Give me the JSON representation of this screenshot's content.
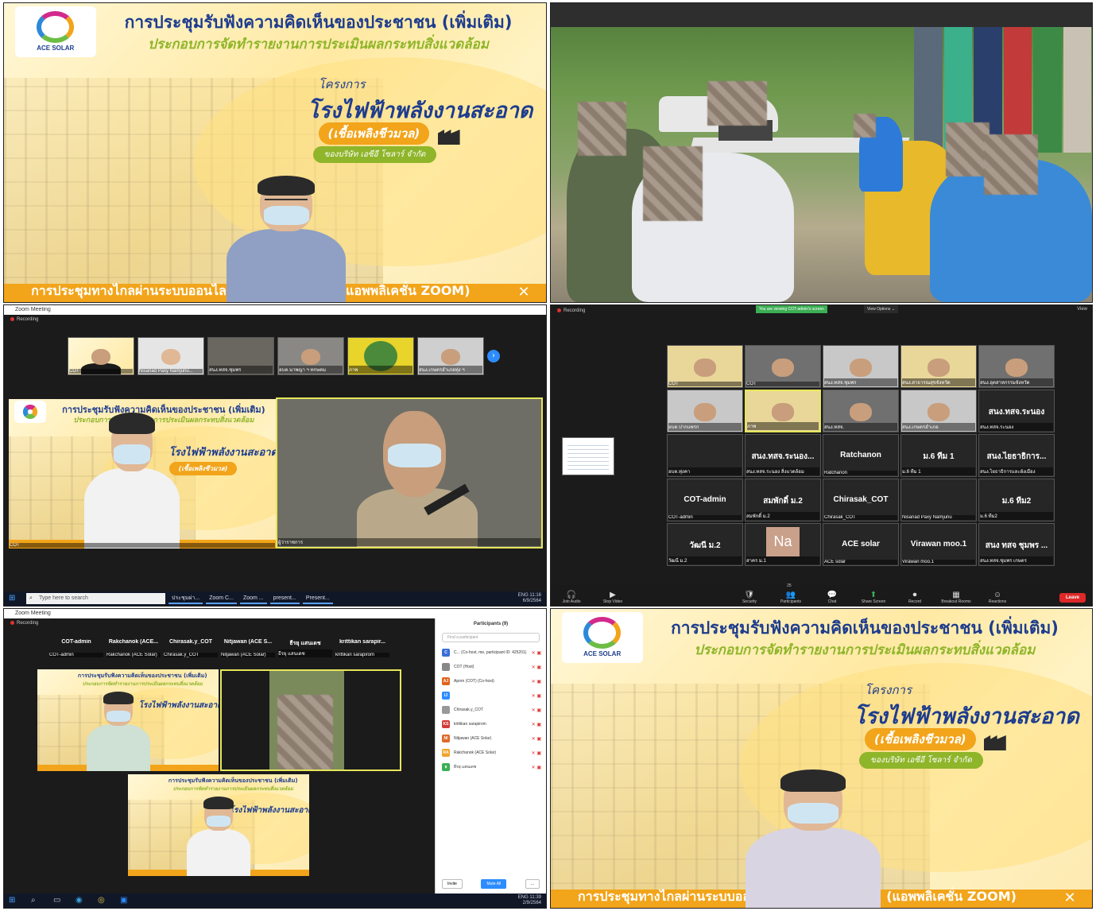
{
  "banner": {
    "logo_text": "ACE SOLAR",
    "title_line1": "การประชุมรับฟังความคิดเห็นของประชาชน (เพิ่มเติม)",
    "title_line2": "ประกอบการจัดทำรายงานการประเมินผลกระทบสิ่งแวดล้อม",
    "project_label": "โครงการ",
    "project_name": "โรงไฟฟ้าพลังงานสะอาด",
    "fuel": "(เชื้อเพลิงชีวมวล)",
    "company": "ของบริษัท เอซีอี โซลาร์ จำกัด",
    "bottom_left": "การประชุมทางไกลผ่านระบบออนไลน์",
    "bottom_right": "(แอพพลิเคชั่น ZOOM)"
  },
  "panel3": {
    "window_title": "Zoom Meeting",
    "recording": "Recording",
    "thumbs": [
      {
        "label": "COT"
      },
      {
        "label": "Nisanad Paxy Namjunu..."
      },
      {
        "label": "สนง.ทสจ.ชุมพร"
      },
      {
        "label": "อบต.นาพญา ฯ ทกษคม"
      },
      {
        "label": "ภาพ"
      },
      {
        "label": "สนง.เกษตรอำเภอทุ่ง ฯ"
      }
    ],
    "main_left_label": "COT",
    "main_right_label": "ผู้ว่าราชการ",
    "taskbar": {
      "search": "Type here to search",
      "items": [
        "ประชุมผ่า...",
        "Zoom C...",
        "Zoom ...",
        "present...",
        "Present..."
      ],
      "lang": "ENG",
      "time": "11:16",
      "date": "6/9/2564"
    }
  },
  "panel4": {
    "recording": "Recording",
    "viewing_banner": "You are viewing COT-admin's screen",
    "view_options": "View Options ⌄",
    "view": "View",
    "grid": [
      {
        "name": "",
        "label": "COT"
      },
      {
        "name": "",
        "label": "COT"
      },
      {
        "name": "",
        "label": "สนง.ทสจ.ชุมพร"
      },
      {
        "name": "",
        "label": "สนง.สาธารณสุขจังหวัด"
      },
      {
        "name": "",
        "label": "สนง.อุตสาหกรรมจังหวัด"
      },
      {
        "name": "",
        "label": "อบต.ปากแพรก"
      },
      {
        "name": "",
        "label": "ภาพ"
      },
      {
        "name": "",
        "label": "สนง.ทสจ."
      },
      {
        "name": "",
        "label": "สนง.เกษตรอำเภอ"
      },
      {
        "name": "สนง.ทสจ.ระนอง",
        "label": "สนง.ทสจ.ระนอง"
      },
      {
        "name": "",
        "label": "อบต.ทุ่งคา"
      },
      {
        "name": "สนง.ทสจ.ระนอง...",
        "label": "สนง.ทสจ.ระนอง สิ่งแวดล้อม"
      },
      {
        "name": "Ratchanon",
        "label": "Ratchanon"
      },
      {
        "name": "ม.6 ทีม 1",
        "label": "ม.6 ทีม 1"
      },
      {
        "name": "สนง.ไยธาธิการ...",
        "label": "สนง.ไยธาธิการและผังเมือง"
      },
      {
        "name": "COT-admin",
        "label": "COT-admin"
      },
      {
        "name": "สมพักดิ์ ม.2",
        "label": "สมพักดิ์ ม.2"
      },
      {
        "name": "Chirasak_COT",
        "label": "Chirasak_COT"
      },
      {
        "name": "",
        "label": "Nisanad Paxy Namjunu"
      },
      {
        "name": "ม.6 ทีม2",
        "label": "ม.6 ทีม2"
      },
      {
        "name": "วัฒนี ม.2",
        "label": "วัฒนี ม.2"
      },
      {
        "name": "Na",
        "label": "สาคร ม.1"
      },
      {
        "name": "ACE solar",
        "label": "ACE solar"
      },
      {
        "name": "Virawan moo.1",
        "label": "Virawan moo.1"
      },
      {
        "name": "สนง ทสจ ชุมพร ...",
        "label": "สนง.ทสจ.ชุมพร เกษตร"
      }
    ],
    "controls": [
      {
        "icon": "🎧",
        "label": "Join Audio"
      },
      {
        "icon": "▶",
        "label": "Stop Video"
      },
      {
        "icon": "🛡",
        "label": "Security"
      },
      {
        "icon": "👥",
        "label": "Participants"
      },
      {
        "icon": "💬",
        "label": "Chat"
      },
      {
        "icon": "⬆",
        "label": "Share Screen"
      },
      {
        "icon": "⏺",
        "label": "Record"
      },
      {
        "icon": "▦",
        "label": "Breakout Rooms"
      },
      {
        "icon": "☺",
        "label": "Reactions"
      }
    ],
    "participants_count": "25",
    "leave": "Leave"
  },
  "panel5": {
    "window_title": "Zoom Meeting",
    "recording": "Recording",
    "top_names": [
      {
        "name": "COT-admin",
        "label": "COT-admin"
      },
      {
        "name": "Rakchanok (ACE...",
        "label": "Rakchanok (ACE Solar)"
      },
      {
        "name": "Chirasak.y_COT",
        "label": "Chirasak.y_COT"
      },
      {
        "name": "Nitjawan (ACE S...",
        "label": "Nitjawan (ACE Solar)"
      },
      {
        "name": "ธีรยุ แสนเดช",
        "label": "ธีรยุ แสนเดช"
      },
      {
        "name": "krittikan sarapir...",
        "label": "krittikan sarapirom"
      }
    ],
    "participants_title": "Participants (9)",
    "find_placeholder": "Find a participant",
    "participants": [
      {
        "av": "C",
        "color": "#3a6fd8",
        "name": "C... (Co-host, me, participant ID: 425201)"
      },
      {
        "av": "",
        "color": "#888888",
        "name": "COT (Host)"
      },
      {
        "av": "AJ",
        "color": "#e0641c",
        "name": "Aporn (COT) (Co-host)"
      },
      {
        "av": "iJ",
        "color": "#2d8cff",
        "name": ""
      },
      {
        "av": "",
        "color": "#999999",
        "name": "Chirasak.y_COT"
      },
      {
        "av": "KS",
        "color": "#d33a3a",
        "name": "krittikan sarapirom"
      },
      {
        "av": "NI",
        "color": "#e06a2a",
        "name": "Nitjawan (ACE Solar)"
      },
      {
        "av": "RA",
        "color": "#f0a42a",
        "name": "Rakchanok (ACE Solar)"
      },
      {
        "av": "ธ",
        "color": "#3cae54",
        "name": "ธีรยุ แสนเดช"
      }
    ],
    "invite": "Invite",
    "mute_all": "Mute All",
    "more": "...",
    "taskbar": {
      "lang": "ENG",
      "time": "11:39",
      "date": "2/9/2564"
    }
  },
  "colors": {
    "navy": "#1d3c8f",
    "green": "#8fb52a",
    "orange": "#f2a41a",
    "zoom_dark": "#1b1b1b",
    "active_speaker": "#e6e65a"
  }
}
